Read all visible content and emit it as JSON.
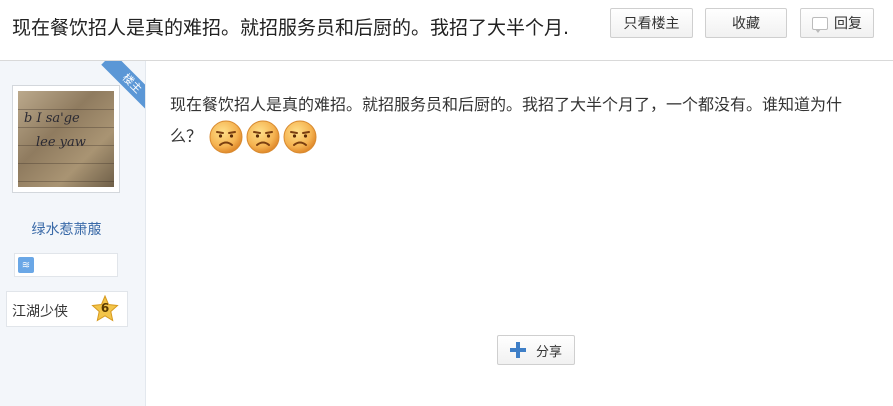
{
  "thread": {
    "title": "现在餐饮招人是真的难招。就招服务员和后厨的。我招了大半个月."
  },
  "toolbar": {
    "only_op_label": "只看楼主",
    "favorite_label": "收藏",
    "reply_label": "回复"
  },
  "author": {
    "op_tag": "楼主",
    "username": "绿水惹萧菔",
    "rank_title": "江湖少侠",
    "level": "6",
    "avatar_icon": "handwriting-avatar",
    "accent_color": "#5b97d6"
  },
  "post": {
    "body": "现在餐饮招人是真的难招。就招服务员和后厨的。我招了大半个月了，一个都没有。谁知道为什么？",
    "emojis": [
      "frown-face-icon",
      "frown-face-icon",
      "frown-face-icon"
    ]
  },
  "share": {
    "label": "分享"
  }
}
